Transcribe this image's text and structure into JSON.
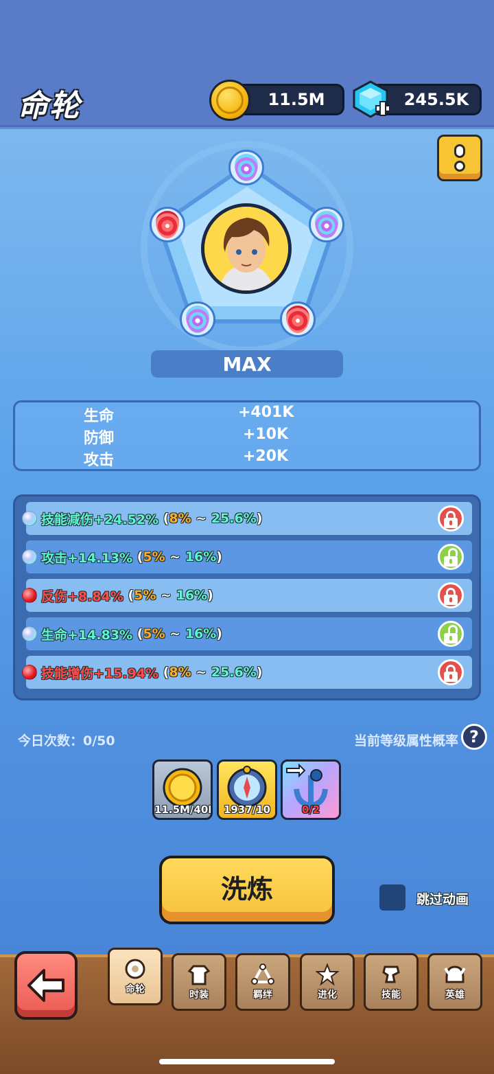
{
  "header": {
    "title": "命轮",
    "coins": "11.5M",
    "gems": "245.5K"
  },
  "wheel": {
    "level_label": "MAX",
    "orbs": [
      {
        "position": "top",
        "color": "purple"
      },
      {
        "position": "left",
        "color": "red"
      },
      {
        "position": "right",
        "color": "purple"
      },
      {
        "position": "bottom-left",
        "color": "purple"
      },
      {
        "position": "bottom-right",
        "color": "red"
      }
    ]
  },
  "stats": [
    {
      "label": "生命",
      "value": "+401K"
    },
    {
      "label": "防御",
      "value": "+10K"
    },
    {
      "label": "攻击",
      "value": "+20K"
    }
  ],
  "attributes": [
    {
      "name": "技能减伤",
      "value": "+24.52%",
      "min": "8%",
      "max": "25.6%",
      "orb": "blue",
      "color": "cyan",
      "locked": true
    },
    {
      "name": "攻击",
      "value": "+14.13%",
      "min": "5%",
      "max": "16%",
      "orb": "blue",
      "color": "cyan",
      "locked": false
    },
    {
      "name": "反伤",
      "value": "+8.84%",
      "min": "5%",
      "max": "16%",
      "orb": "red",
      "color": "red",
      "locked": true
    },
    {
      "name": "生命",
      "value": "+14.83%",
      "min": "5%",
      "max": "16%",
      "orb": "blue",
      "color": "cyan",
      "locked": false
    },
    {
      "name": "技能增伤",
      "value": "+15.94%",
      "min": "8%",
      "max": "25.6%",
      "orb": "red",
      "color": "red",
      "locked": true
    }
  ],
  "daily": {
    "label": "今日次数：0/50",
    "probability_label": "当前等级属性概率",
    "help_glyph": "?"
  },
  "costs": [
    {
      "icon": "coin-icon",
      "text": "11.5M/40K"
    },
    {
      "icon": "compass-icon",
      "text": "1937/10"
    },
    {
      "icon": "anchor-icon",
      "text": "0/2"
    }
  ],
  "actions": {
    "refine_label": "洗炼",
    "skip_label": "跳过动画"
  },
  "nav": {
    "tabs": [
      {
        "label": "命轮",
        "icon": "wheel-icon",
        "active": true
      },
      {
        "label": "时装",
        "icon": "outfit-icon",
        "active": false
      },
      {
        "label": "羁绊",
        "icon": "bond-icon",
        "active": false
      },
      {
        "label": "进化",
        "icon": "evolve-icon",
        "active": false
      },
      {
        "label": "技能",
        "icon": "skill-icon",
        "active": false
      },
      {
        "label": "英雄",
        "icon": "hero-icon",
        "active": false
      }
    ]
  },
  "colors": {
    "cyan_text": "#5df5d4",
    "red_text": "#ff4d4d",
    "orange_text": "#ffac27",
    "lock_locked": "#e4514d",
    "lock_unlocked": "#8ed04a"
  }
}
